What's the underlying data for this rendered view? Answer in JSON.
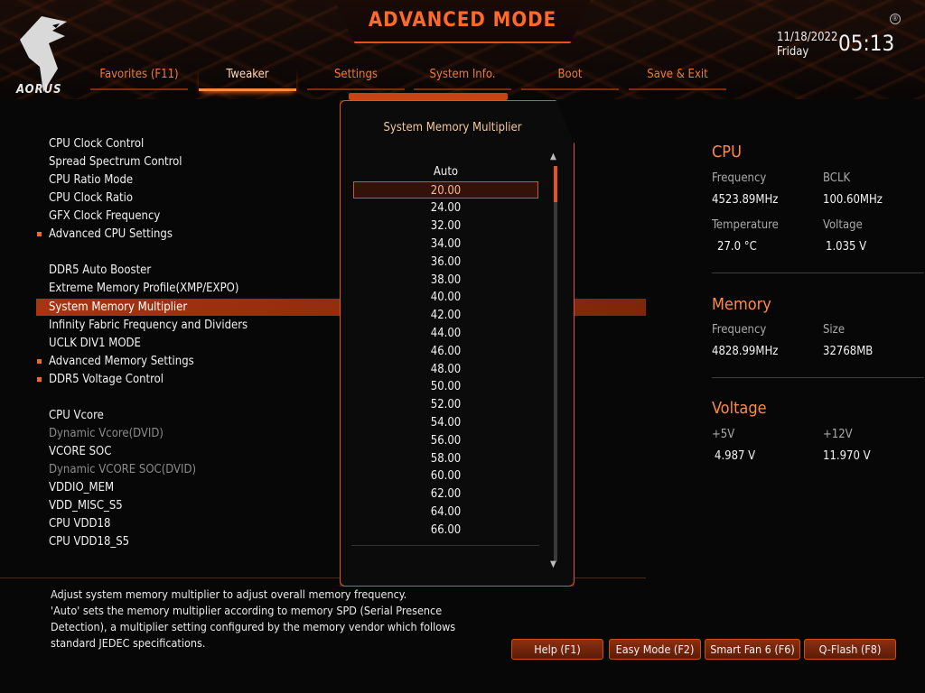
{
  "header": {
    "title": "ADVANCED MODE",
    "brand": "AORUS",
    "date": "11/18/2022",
    "day": "Friday",
    "time": "05:13"
  },
  "tabs": [
    {
      "label": "Favorites (F11)",
      "active": false
    },
    {
      "label": "Tweaker",
      "active": true
    },
    {
      "label": "Settings",
      "active": false
    },
    {
      "label": "System Info.",
      "active": false
    },
    {
      "label": "Boot",
      "active": false
    },
    {
      "label": "Save & Exit",
      "active": false
    }
  ],
  "menu": {
    "items": [
      {
        "label": "CPU Clock Control"
      },
      {
        "label": "Spread Spectrum Control"
      },
      {
        "label": "CPU Ratio Mode"
      },
      {
        "label": "CPU Clock Ratio"
      },
      {
        "label": "GFX Clock Frequency"
      },
      {
        "label": "Advanced CPU Settings"
      },
      {
        "label": "DDR5 Auto Booster"
      },
      {
        "label": "Extreme Memory Profile(XMP/EXPO)"
      },
      {
        "label": "System Memory Multiplier"
      },
      {
        "label": "Infinity Fabric Frequency and Dividers"
      },
      {
        "label": "UCLK DIV1 MODE"
      },
      {
        "label": "Advanced Memory Settings"
      },
      {
        "label": "DDR5 Voltage Control"
      },
      {
        "label": "CPU Vcore"
      },
      {
        "label": "Dynamic Vcore(DVID)"
      },
      {
        "label": "VCORE SOC"
      },
      {
        "label": "Dynamic VCORE SOC(DVID)"
      },
      {
        "label": "VDDIO_MEM"
      },
      {
        "label": "VDD_MISC_S5"
      },
      {
        "label": "CPU VDD18"
      },
      {
        "label": "CPU VDD18_S5"
      }
    ]
  },
  "help_text": {
    "line1": "Adjust system memory multiplier to adjust overall memory frequency.",
    "line2": "'Auto' sets the memory multiplier according to memory SPD (Serial Presence",
    "line3": "Detection), a multiplier setting configured by the memory vendor which follows",
    "line4": "standard JEDEC specifications."
  },
  "popup": {
    "title": "System Memory Multiplier",
    "options": [
      "Auto",
      "20.00",
      "24.00",
      "32.00",
      "34.00",
      "36.00",
      "38.00",
      "40.00",
      "42.00",
      "44.00",
      "46.00",
      "48.00",
      "50.00",
      "52.00",
      "54.00",
      "56.00",
      "58.00",
      "60.00",
      "62.00",
      "64.00",
      "66.00"
    ],
    "current": "20.00"
  },
  "cpu": {
    "title": "CPU",
    "frequency_label": "Frequency",
    "frequency": "4523.89MHz",
    "bclk_label": "BCLK",
    "bclk": "100.60MHz",
    "temperature_label": "Temperature",
    "temperature": "27.0 °C",
    "voltage_label": "Voltage",
    "voltage": "1.035 V"
  },
  "memory": {
    "title": "Memory",
    "frequency_label": "Frequency",
    "frequency": "4828.99MHz",
    "size_label": "Size",
    "size": "32768MB"
  },
  "voltage": {
    "title": "Voltage",
    "v5_label": "+5V",
    "v5": "4.987 V",
    "v12_label": "+12V",
    "v12": "11.970 V"
  },
  "function_keys": {
    "help": "Help (F1)",
    "easy_mode": "Easy Mode (F2)",
    "smart_fan": "Smart Fan 6 (F6)",
    "qflash": "Q-Flash (F8)"
  },
  "colors": {
    "accent": "#ff6a2a",
    "selected_row": "#a83410"
  }
}
